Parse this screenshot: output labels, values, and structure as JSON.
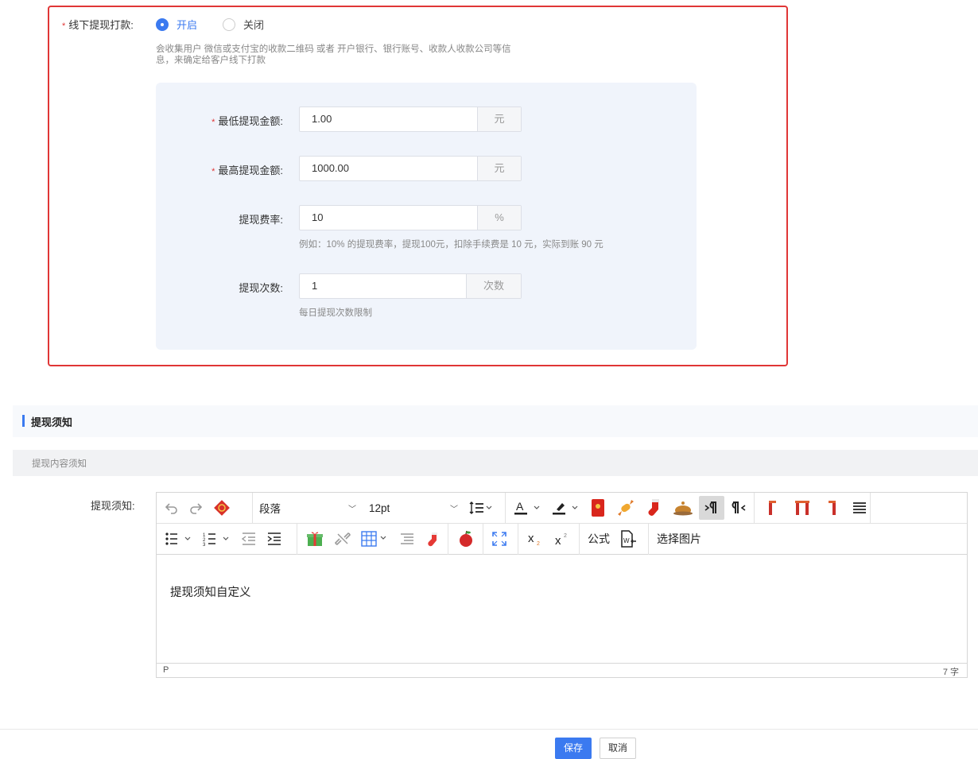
{
  "offline": {
    "label": "线下提现打款:",
    "options": [
      "开启",
      "关闭"
    ],
    "selected": "开启",
    "description": "会收集用户 微信或支付宝的收款二维码 或者 开户银行、银行账号、收款人收款公司等信息，来确定给客户线下打款"
  },
  "fields": {
    "min": {
      "label": "最低提现金额:",
      "value": "1.00",
      "suffix": "元"
    },
    "max": {
      "label": "最高提现金额:",
      "value": "1000.00",
      "suffix": "元"
    },
    "rate": {
      "label": "提现费率:",
      "value": "10",
      "suffix": "%",
      "hint": "例如：10% 的提现费率，提现100元，扣除手续费是 10 元，实际到账 90 元"
    },
    "times": {
      "label": "提现次数:",
      "value": "1",
      "suffix": "次数",
      "hint": "每日提现次数限制"
    }
  },
  "section": {
    "title": "提现须知",
    "subtitle": "提现内容须知"
  },
  "editor": {
    "label": "提现须知:",
    "block_format": "段落",
    "font_size": "12pt",
    "formula_label": "公式",
    "image_label": "选择图片",
    "content": "提现须知自定义",
    "status_path": "P",
    "word_count": "7 字"
  },
  "footer": {
    "save": "保存",
    "cancel": "取消"
  },
  "colors": {
    "primary": "#3b7af0",
    "highlight_border": "#e03636"
  }
}
